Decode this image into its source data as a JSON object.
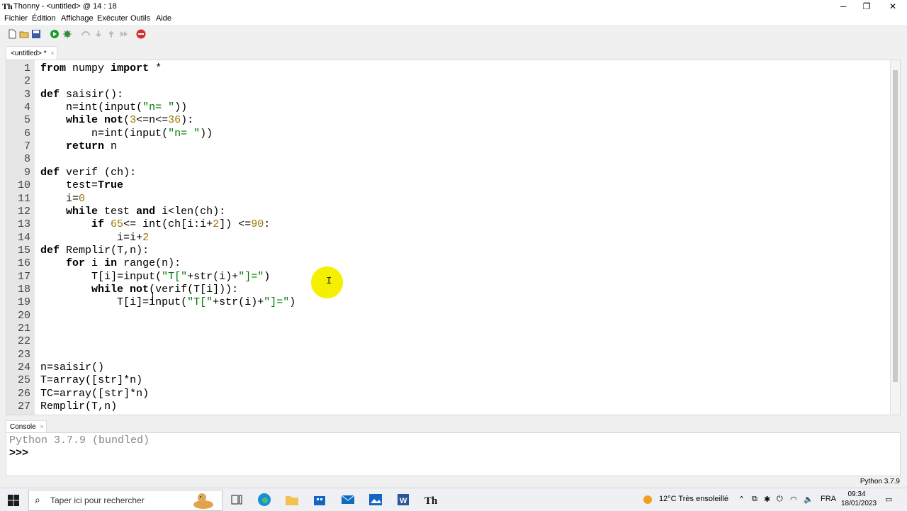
{
  "window": {
    "title": "Thonny  -  <untitled>  @  14 : 18",
    "controls": {
      "minimize": "─",
      "maximize": "❐",
      "close": "✕"
    }
  },
  "menu": [
    "Fichier",
    "Édition",
    "Affichage",
    "Exécuter",
    "Outils",
    "Aide"
  ],
  "toolbar": [
    "new-file",
    "open",
    "save",
    "run",
    "debug",
    "step-over",
    "step-into",
    "step-out",
    "resume",
    "stop"
  ],
  "editor_tab": {
    "label": "<untitled> *",
    "close": "×"
  },
  "code": [
    "from numpy import *",
    "",
    "def saisir():",
    "    n=int(input(\"n= \"))",
    "    while not(3<=n<=36):",
    "        n=int(input(\"n= \"))",
    "    return n",
    "",
    "def verif (ch):",
    "    test=True",
    "    i=0",
    "    while test and i<len(ch):",
    "        if 65<= int(ch[i:i+2]) <=90:",
    "            i=i+2",
    "def Remplir(T,n):",
    "    for i in range(n):",
    "        T[i]=input(\"T[\"+str(i)+\"]=\")",
    "        while not(verif(T[i])):",
    "            T[i]=input(\"T[\"+str(i)+\"]=\")",
    "",
    "",
    "",
    "",
    "n=saisir()",
    "T=array([str]*n)",
    "TC=array([str]*n)",
    "Remplir(T,n)"
  ],
  "console": {
    "tab_label": "Console",
    "close": "×",
    "version_line": "Python 3.7.9 (bundled)",
    "prompt": ">>>"
  },
  "status": {
    "interpreter": "Python 3.7.9"
  },
  "taskbar": {
    "search_placeholder": "Taper ici pour rechercher",
    "weather": "12°C  Très ensoleillé",
    "lang": "FRA",
    "time": "09:34",
    "date": "18/01/2023"
  }
}
